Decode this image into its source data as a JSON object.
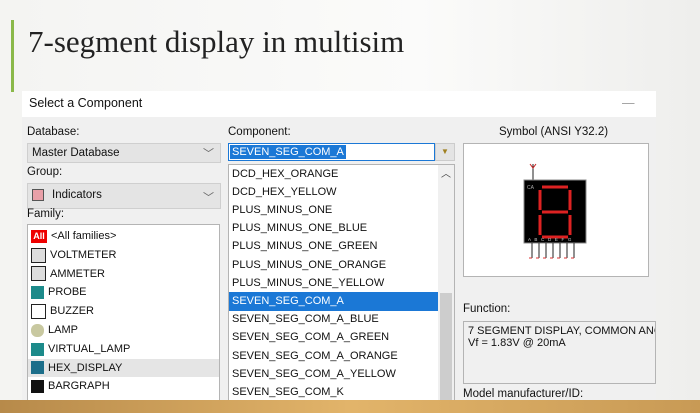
{
  "slide": {
    "title": "7-segment display in multisim"
  },
  "dialog": {
    "title": "Select a Component",
    "database_label": "Database:",
    "database_value": "Master Database",
    "group_label": "Group:",
    "group_value": "Indicators",
    "family_label": "Family:",
    "families": [
      {
        "label": "<All families>",
        "icon": "all-icon"
      },
      {
        "label": "VOLTMETER",
        "icon": "voltmeter-icon"
      },
      {
        "label": "AMMETER",
        "icon": "ammeter-icon"
      },
      {
        "label": "PROBE",
        "icon": "probe-icon"
      },
      {
        "label": "BUZZER",
        "icon": "buzzer-icon"
      },
      {
        "label": "LAMP",
        "icon": "lamp-icon"
      },
      {
        "label": "VIRTUAL_LAMP",
        "icon": "virtual-lamp-icon"
      },
      {
        "label": "HEX_DISPLAY",
        "icon": "hex-display-icon"
      },
      {
        "label": "BARGRAPH",
        "icon": "bargraph-icon"
      }
    ],
    "component_label": "Component:",
    "component_value": "SEVEN_SEG_COM_A",
    "components": [
      "DCD_HEX_ORANGE",
      "DCD_HEX_YELLOW",
      "PLUS_MINUS_ONE",
      "PLUS_MINUS_ONE_BLUE",
      "PLUS_MINUS_ONE_GREEN",
      "PLUS_MINUS_ONE_ORANGE",
      "PLUS_MINUS_ONE_YELLOW",
      "SEVEN_SEG_COM_A",
      "SEVEN_SEG_COM_A_BLUE",
      "SEVEN_SEG_COM_A_GREEN",
      "SEVEN_SEG_COM_A_ORANGE",
      "SEVEN_SEG_COM_A_YELLOW",
      "SEVEN_SEG_COM_K"
    ],
    "selected_component": "SEVEN_SEG_COM_A",
    "symbol_label": "Symbol (ANSI Y32.2)",
    "symbol_pins": {
      "top": "CA",
      "bottom": "A B C D E F G"
    },
    "function_label": "Function:",
    "function_text": [
      "7 SEGMENT DISPLAY, COMMON ANC",
      "Vf = 1.83V @ 20mA"
    ],
    "model_label": "Model manufacturer/ID:"
  }
}
